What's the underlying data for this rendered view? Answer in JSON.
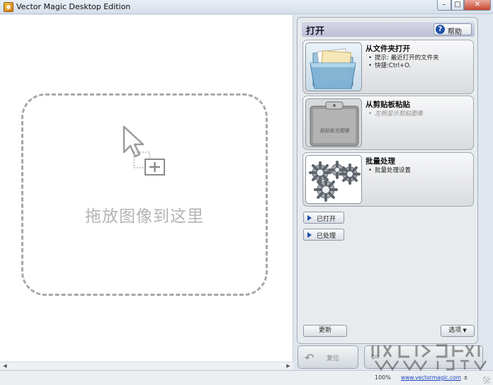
{
  "window": {
    "title": "Vector Magic Desktop Edition",
    "controls": {
      "minimize": "–",
      "maximize": "□",
      "close": "✕"
    }
  },
  "canvas": {
    "drop_text": "拖放图像到这里",
    "drop_icon": "cursor-drag-add-icon"
  },
  "panel": {
    "title": "打开",
    "help": {
      "icon": "?",
      "label": "帮助"
    },
    "cards": [
      {
        "title": "从文件夹打开",
        "icon": "folder-icon",
        "bullets": [
          "提示: 最近打开的文件夹",
          "快捷:Ctrl+O."
        ],
        "enabled": true
      },
      {
        "title": "从剪贴板粘贴",
        "icon": "clipboard-icon",
        "thumb_text": "剪贴板无图像",
        "bullets": [
          "左侧显示剪贴图像"
        ],
        "enabled": false
      },
      {
        "title": "批量处理",
        "icon": "gears-icon",
        "bullets": [
          "批量处理设置"
        ],
        "enabled": true
      }
    ],
    "opened_label": "已打开",
    "processed_label": "已处理",
    "update_label": "更新",
    "options_label": "选项"
  },
  "bottom": {
    "reset_label": "复位"
  },
  "status": {
    "zoom": "100%",
    "link": "www.vectormagic.com",
    "end": "±"
  },
  "colors": {
    "accent": "#1f4fa6",
    "panel_header": "#c6c9dc",
    "dropzone_border": "#a8a8a8"
  }
}
